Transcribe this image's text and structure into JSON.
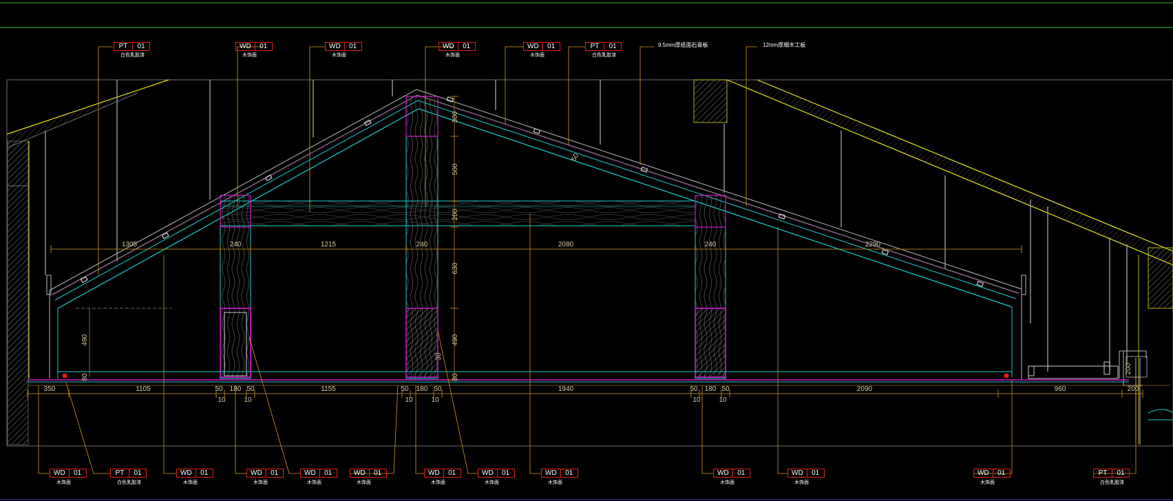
{
  "colors": {
    "background": "#000000",
    "frame_green": "#2fbf3a",
    "beam_cyan": "#19d1d1",
    "leader_orange": "#d79a20",
    "tag_red": "#e0201c",
    "post_magenta": "#d21bd2",
    "roof_yellow": "#e8e01a",
    "dim_tan": "#d9c9a0",
    "hatch_gray": "#8c8c8c",
    "white": "#ffffff"
  },
  "top_tags": [
    {
      "code": "PT",
      "num": "01",
      "sub": "白色乳胶漆"
    },
    {
      "code": "WD",
      "num": "01",
      "sub": "木饰面"
    },
    {
      "code": "WD",
      "num": "01",
      "sub": "木饰面"
    },
    {
      "code": "WD",
      "num": "01",
      "sub": "木饰面"
    },
    {
      "code": "WD",
      "num": "01",
      "sub": "木饰面"
    },
    {
      "code": "PT",
      "num": "01",
      "sub": "白色乳胶漆"
    }
  ],
  "top_notes": [
    "9.5mm厚纸面石膏板",
    "12mm厚细木工板"
  ],
  "bottom_tags": [
    {
      "code": "WD",
      "num": "01",
      "sub": "木饰面"
    },
    {
      "code": "PT",
      "num": "01",
      "sub": "白色乳胶漆"
    },
    {
      "code": "WD",
      "num": "01",
      "sub": "木饰面"
    },
    {
      "code": "WD",
      "num": "01",
      "sub": "木饰面"
    },
    {
      "code": "WD",
      "num": "01",
      "sub": "木饰面"
    },
    {
      "code": "WD",
      "num": "01",
      "sub": "木饰面"
    },
    {
      "code": "WD",
      "num": "01",
      "sub": "木饰面"
    },
    {
      "code": "WD",
      "num": "01",
      "sub": "木饰面"
    },
    {
      "code": "WD",
      "num": "01",
      "sub": "木饰面"
    },
    {
      "code": "WD",
      "num": "01",
      "sub": "木饰面"
    },
    {
      "code": "WD",
      "num": "01",
      "sub": "木饰面"
    },
    {
      "code": "WD",
      "num": "01",
      "sub": "木饰面"
    },
    {
      "code": "PT",
      "num": "01",
      "sub": "白色乳胶漆"
    }
  ],
  "dims_beam_line": [
    "1305",
    "240",
    "1215",
    "240",
    "2080",
    "240",
    "2290"
  ],
  "dims_bottom_line": [
    "350",
    "1105",
    "50",
    "180",
    "50",
    "1155",
    "50",
    "180",
    "50",
    "1940",
    "50",
    "180",
    "50",
    "2090",
    "960",
    "200"
  ],
  "dims_small": [
    "10",
    "10",
    "10",
    "10",
    "10",
    "10"
  ],
  "dims_vertical_center": [
    "300",
    "500",
    "200",
    "630",
    "490"
  ],
  "dims_misc": [
    "490",
    "80",
    "80",
    "30",
    "50",
    "200"
  ]
}
